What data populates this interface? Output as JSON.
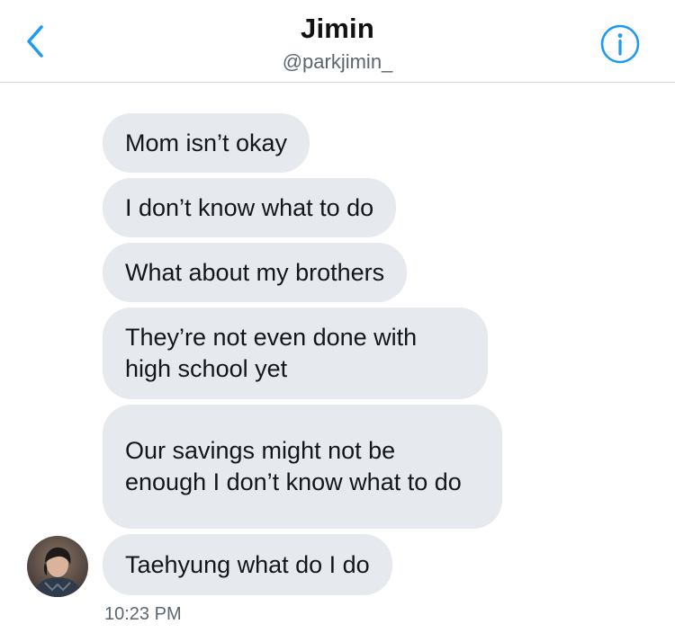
{
  "header": {
    "title": "Jimin",
    "handle": "@parkjimin_"
  },
  "messages": [
    {
      "text": "Mom isn’t okay"
    },
    {
      "text": "I don’t know what to do"
    },
    {
      "text": "What about my brothers"
    },
    {
      "text": "They’re not even done with high school yet"
    },
    {
      "text": "Our savings might not be enough I don’t know what to do"
    },
    {
      "text": "Taehyung what do I do"
    }
  ],
  "timestamp": "10:23 PM",
  "colors": {
    "accent": "#1d9bf0",
    "bubble_bg": "#e6e9ed",
    "secondary_text": "#5c6670"
  },
  "icons": {
    "back": "chevron-left-icon",
    "info": "info-circle-icon"
  }
}
